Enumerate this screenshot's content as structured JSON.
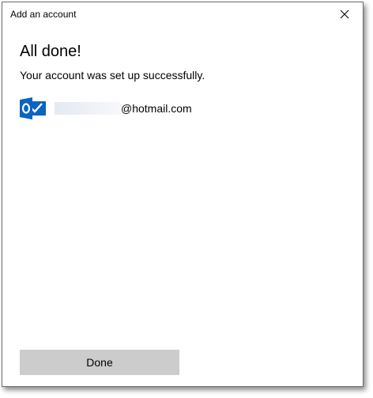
{
  "window": {
    "title": "Add an account",
    "close_icon": "close-icon"
  },
  "content": {
    "heading": "All done!",
    "message": "Your account was set up successfully.",
    "account": {
      "icon": "outlook-icon",
      "email_visible_part": "@hotmail.com"
    }
  },
  "footer": {
    "done_label": "Done"
  },
  "colors": {
    "outlook_blue": "#0a64c2",
    "button_gray": "#cccccc"
  }
}
